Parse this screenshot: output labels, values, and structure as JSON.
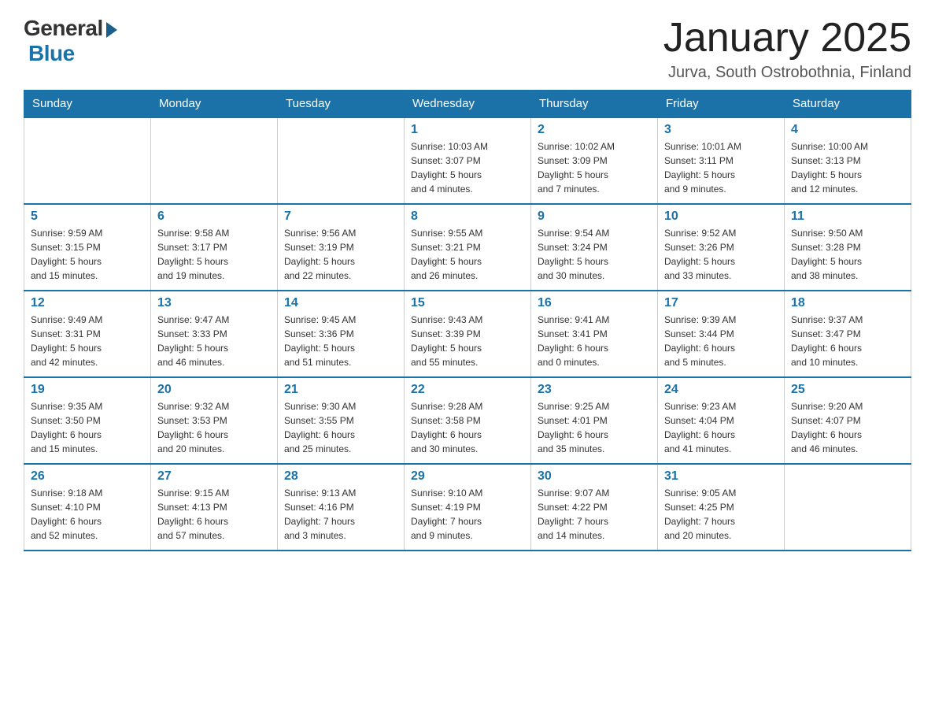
{
  "logo": {
    "general": "General",
    "blue": "Blue",
    "tagline": "Blue"
  },
  "header": {
    "month_title": "January 2025",
    "location": "Jurva, South Ostrobothnia, Finland"
  },
  "weekdays": [
    "Sunday",
    "Monday",
    "Tuesday",
    "Wednesday",
    "Thursday",
    "Friday",
    "Saturday"
  ],
  "weeks": [
    [
      {
        "day": "",
        "info": ""
      },
      {
        "day": "",
        "info": ""
      },
      {
        "day": "",
        "info": ""
      },
      {
        "day": "1",
        "info": "Sunrise: 10:03 AM\nSunset: 3:07 PM\nDaylight: 5 hours\nand 4 minutes."
      },
      {
        "day": "2",
        "info": "Sunrise: 10:02 AM\nSunset: 3:09 PM\nDaylight: 5 hours\nand 7 minutes."
      },
      {
        "day": "3",
        "info": "Sunrise: 10:01 AM\nSunset: 3:11 PM\nDaylight: 5 hours\nand 9 minutes."
      },
      {
        "day": "4",
        "info": "Sunrise: 10:00 AM\nSunset: 3:13 PM\nDaylight: 5 hours\nand 12 minutes."
      }
    ],
    [
      {
        "day": "5",
        "info": "Sunrise: 9:59 AM\nSunset: 3:15 PM\nDaylight: 5 hours\nand 15 minutes."
      },
      {
        "day": "6",
        "info": "Sunrise: 9:58 AM\nSunset: 3:17 PM\nDaylight: 5 hours\nand 19 minutes."
      },
      {
        "day": "7",
        "info": "Sunrise: 9:56 AM\nSunset: 3:19 PM\nDaylight: 5 hours\nand 22 minutes."
      },
      {
        "day": "8",
        "info": "Sunrise: 9:55 AM\nSunset: 3:21 PM\nDaylight: 5 hours\nand 26 minutes."
      },
      {
        "day": "9",
        "info": "Sunrise: 9:54 AM\nSunset: 3:24 PM\nDaylight: 5 hours\nand 30 minutes."
      },
      {
        "day": "10",
        "info": "Sunrise: 9:52 AM\nSunset: 3:26 PM\nDaylight: 5 hours\nand 33 minutes."
      },
      {
        "day": "11",
        "info": "Sunrise: 9:50 AM\nSunset: 3:28 PM\nDaylight: 5 hours\nand 38 minutes."
      }
    ],
    [
      {
        "day": "12",
        "info": "Sunrise: 9:49 AM\nSunset: 3:31 PM\nDaylight: 5 hours\nand 42 minutes."
      },
      {
        "day": "13",
        "info": "Sunrise: 9:47 AM\nSunset: 3:33 PM\nDaylight: 5 hours\nand 46 minutes."
      },
      {
        "day": "14",
        "info": "Sunrise: 9:45 AM\nSunset: 3:36 PM\nDaylight: 5 hours\nand 51 minutes."
      },
      {
        "day": "15",
        "info": "Sunrise: 9:43 AM\nSunset: 3:39 PM\nDaylight: 5 hours\nand 55 minutes."
      },
      {
        "day": "16",
        "info": "Sunrise: 9:41 AM\nSunset: 3:41 PM\nDaylight: 6 hours\nand 0 minutes."
      },
      {
        "day": "17",
        "info": "Sunrise: 9:39 AM\nSunset: 3:44 PM\nDaylight: 6 hours\nand 5 minutes."
      },
      {
        "day": "18",
        "info": "Sunrise: 9:37 AM\nSunset: 3:47 PM\nDaylight: 6 hours\nand 10 minutes."
      }
    ],
    [
      {
        "day": "19",
        "info": "Sunrise: 9:35 AM\nSunset: 3:50 PM\nDaylight: 6 hours\nand 15 minutes."
      },
      {
        "day": "20",
        "info": "Sunrise: 9:32 AM\nSunset: 3:53 PM\nDaylight: 6 hours\nand 20 minutes."
      },
      {
        "day": "21",
        "info": "Sunrise: 9:30 AM\nSunset: 3:55 PM\nDaylight: 6 hours\nand 25 minutes."
      },
      {
        "day": "22",
        "info": "Sunrise: 9:28 AM\nSunset: 3:58 PM\nDaylight: 6 hours\nand 30 minutes."
      },
      {
        "day": "23",
        "info": "Sunrise: 9:25 AM\nSunset: 4:01 PM\nDaylight: 6 hours\nand 35 minutes."
      },
      {
        "day": "24",
        "info": "Sunrise: 9:23 AM\nSunset: 4:04 PM\nDaylight: 6 hours\nand 41 minutes."
      },
      {
        "day": "25",
        "info": "Sunrise: 9:20 AM\nSunset: 4:07 PM\nDaylight: 6 hours\nand 46 minutes."
      }
    ],
    [
      {
        "day": "26",
        "info": "Sunrise: 9:18 AM\nSunset: 4:10 PM\nDaylight: 6 hours\nand 52 minutes."
      },
      {
        "day": "27",
        "info": "Sunrise: 9:15 AM\nSunset: 4:13 PM\nDaylight: 6 hours\nand 57 minutes."
      },
      {
        "day": "28",
        "info": "Sunrise: 9:13 AM\nSunset: 4:16 PM\nDaylight: 7 hours\nand 3 minutes."
      },
      {
        "day": "29",
        "info": "Sunrise: 9:10 AM\nSunset: 4:19 PM\nDaylight: 7 hours\nand 9 minutes."
      },
      {
        "day": "30",
        "info": "Sunrise: 9:07 AM\nSunset: 4:22 PM\nDaylight: 7 hours\nand 14 minutes."
      },
      {
        "day": "31",
        "info": "Sunrise: 9:05 AM\nSunset: 4:25 PM\nDaylight: 7 hours\nand 20 minutes."
      },
      {
        "day": "",
        "info": ""
      }
    ]
  ]
}
